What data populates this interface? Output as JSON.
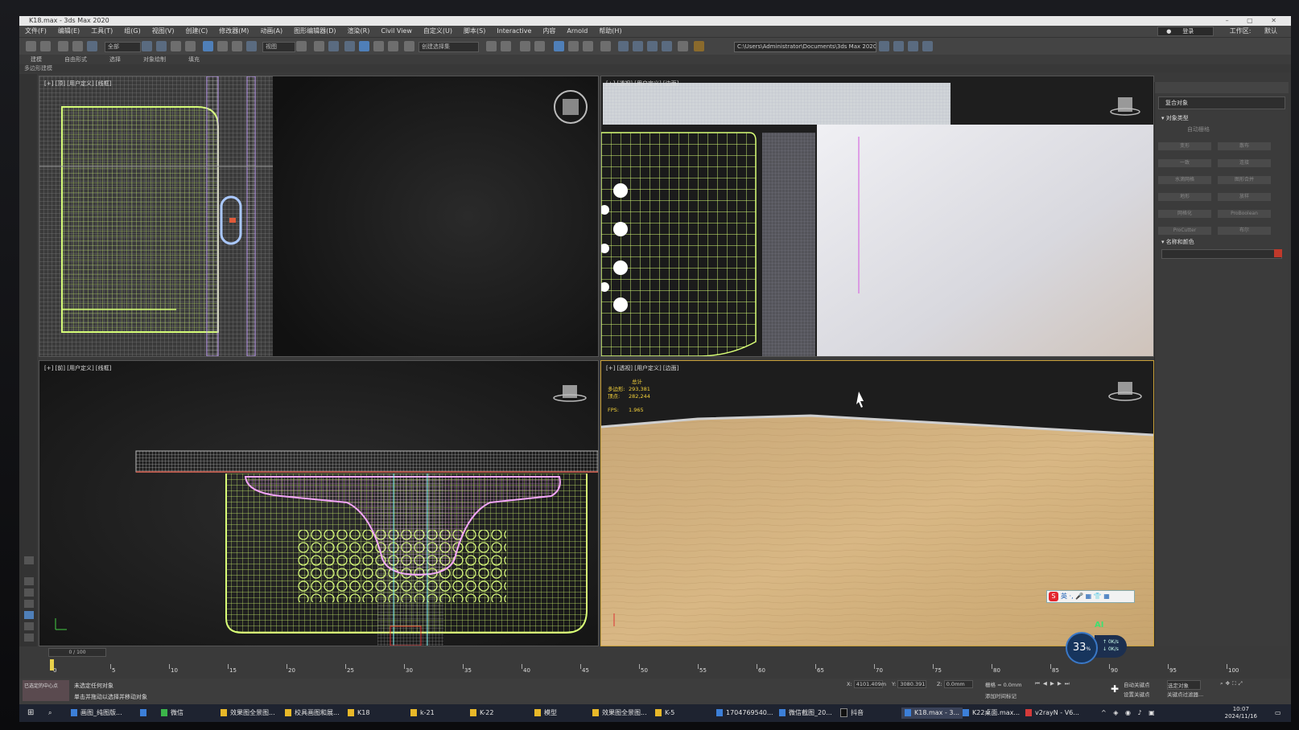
{
  "window": {
    "title": "K18.max - 3ds Max 2020"
  },
  "menu": {
    "items": [
      "文件(F)",
      "编辑(E)",
      "工具(T)",
      "组(G)",
      "视图(V)",
      "创建(C)",
      "修改器(M)",
      "动画(A)",
      "图形编辑器(D)",
      "渲染(R)",
      "Civil View",
      "自定义(U)",
      "脚本(S)",
      "Interactive",
      "内容",
      "Arnold",
      "帮助(H)"
    ],
    "signin": "登录",
    "workspace_label": "工作区:",
    "workspace_value": "默认"
  },
  "toolbar": {
    "select_filter": "全部",
    "ref_coord": "视图",
    "named_selection": "创建选择集",
    "project_path": "C:\\Users\\Administrator\\Documents\\3ds Max 2020"
  },
  "ribbon": {
    "tabs": [
      "建模",
      "自由形式",
      "选择",
      "对象绘制",
      "填充"
    ],
    "sub": "多边形建模"
  },
  "viewports": {
    "top_left_label": "[+] [顶] [用户定义] [线框]",
    "top_right_label": "[+] [透视] [用户定义] [边面]",
    "bottom_left_label": "[+] [前] [用户定义] [线框]",
    "bottom_right_label": "[+] [透视] [用户定义] [边面]",
    "stats": {
      "header": "总计",
      "polys_label": "多边形:",
      "polys_value": "293,381",
      "verts_label": "顶点:",
      "verts_value": "282,244",
      "fps_label": "FPS:",
      "fps_value": "1.965"
    }
  },
  "command_panel": {
    "dropdown": "复合对象",
    "object_type_header": "对象类型",
    "autogrid": "自动栅格",
    "buttons": [
      "变形",
      "散布",
      "一致",
      "连接",
      "水滴网格",
      "图形合并",
      "地形",
      "放样",
      "网格化",
      "ProBoolean",
      "ProCutter",
      "布尔"
    ],
    "name_color_header": "名称和颜色",
    "accent_color": "#c0392b"
  },
  "timeline": {
    "frame_display": "0 / 100",
    "ticks": [
      0,
      5,
      10,
      15,
      20,
      25,
      30,
      35,
      40,
      45,
      50,
      55,
      60,
      65,
      70,
      75,
      80,
      85,
      90,
      95,
      100
    ]
  },
  "status": {
    "maxscript_hint": "已选定的中心点",
    "message1": "未选定任何对象",
    "message2": "单击并拖动以选择并移动对象",
    "x_label": "X:",
    "x_value": "4101.409m",
    "y_label": "Y:",
    "y_value": "3080.391",
    "z_label": "Z:",
    "z_value": "0.0mm",
    "grid_label": "栅格 = 0.0mm",
    "add_time_tag": "添加时间标记",
    "autokey": "自动关键点",
    "setkey": "设置关键点",
    "selected_object": "选定对象",
    "keyfilter": "关键点过滤器..."
  },
  "taskbar": {
    "items": [
      {
        "label": "画图_纯图版...",
        "color": "b"
      },
      {
        "label": "",
        "color": "b"
      },
      {
        "label": "微信",
        "color": "g"
      },
      {
        "label": "效果图全景图...",
        "color": "y"
      },
      {
        "label": "校具画图和展...",
        "color": "y"
      },
      {
        "label": "K18",
        "color": "y"
      },
      {
        "label": "k-21",
        "color": "y"
      },
      {
        "label": "K-22",
        "color": "y"
      },
      {
        "label": "模型",
        "color": "y"
      },
      {
        "label": "效果图全景图...",
        "color": "y"
      },
      {
        "label": "K-5",
        "color": "y"
      },
      {
        "label": "1704769540...",
        "color": "b"
      },
      {
        "label": "微信截图_20...",
        "color": "b"
      },
      {
        "label": "抖音",
        "color": "k"
      },
      {
        "label": "K18.max - 3...",
        "color": "b"
      },
      {
        "label": "K22桌面.max...",
        "color": "b"
      },
      {
        "label": "v2rayN - V6...",
        "color": "r"
      }
    ],
    "time": "10:07",
    "date": "2024/11/16"
  },
  "overlay": {
    "ime_label": "英",
    "cpu_percent": "33",
    "percent_sign": "%",
    "up_speed": "0K/s",
    "down_speed": "0K/s",
    "ai_badge": "AI"
  }
}
